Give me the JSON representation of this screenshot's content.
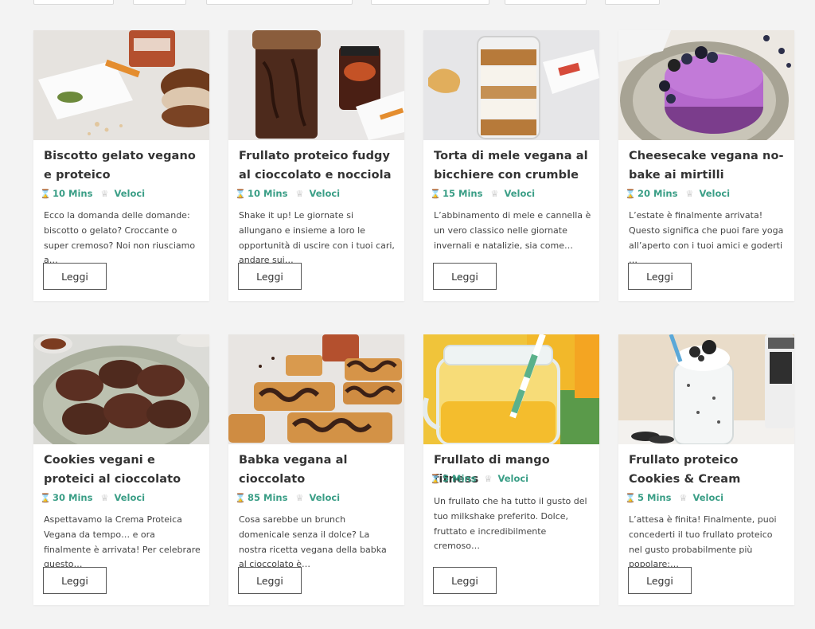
{
  "more_label": "Leggi",
  "recipes": [
    {
      "title": "Biscotto gelato vegano e proteico",
      "time": "10 Mins",
      "speed": "Veloci",
      "excerpt": "Ecco la domanda delle domande: biscotto o gelato? Croccante o super cremoso? Noi non riusciamo a…"
    },
    {
      "title": "Frullato proteico fudgy al cioccolato e nocciola",
      "time": "10 Mins",
      "speed": "Veloci",
      "excerpt": "Shake it up! Le giornate si allungano e insieme a loro le opportunità di uscire con i tuoi cari, andare sui…"
    },
    {
      "title": "Torta di mele vegana al bicchiere con crumble",
      "time": "15 Mins",
      "speed": "Veloci",
      "excerpt": "L’abbinamento di mele e cannella è un vero classico nelle giornate invernali e natalizie, sia come…"
    },
    {
      "title": "Cheesecake vegana no-bake ai mirtilli",
      "time": "20 Mins",
      "speed": "Veloci",
      "excerpt": "L’estate è finalmente arrivata! Questo significa che puoi fare yoga all’aperto con i tuoi amici e goderti …"
    },
    {
      "title": "Cookies vegani e proteici al cioccolato",
      "time": "30 Mins",
      "speed": "Veloci",
      "excerpt": "Aspettavamo la Crema Proteica Vegana da tempo… e ora finalmente è arrivata! Per celebrare questo…"
    },
    {
      "title": "Babka vegana al cioccolato",
      "time": "85 Mins",
      "speed": "Veloci",
      "excerpt": "Cosa sarebbe un brunch domenicale senza il dolce? La nostra ricetta vegana della babka al cioccolato è…"
    },
    {
      "title": "Frullato di mango fitness",
      "time": "5 Mins",
      "speed": "Veloci",
      "excerpt": "Un frullato che ha tutto il gusto del tuo milkshake preferito. Dolce, fruttato e incredibilmente cremoso…"
    },
    {
      "title": "Frullato proteico Cookies & Cream",
      "time": "5 Mins",
      "speed": "Veloci",
      "excerpt": "L’attesa è finita! Finalmente, puoi concederti il tuo frullato proteico nel gusto probabilmente più popolare:…"
    }
  ]
}
